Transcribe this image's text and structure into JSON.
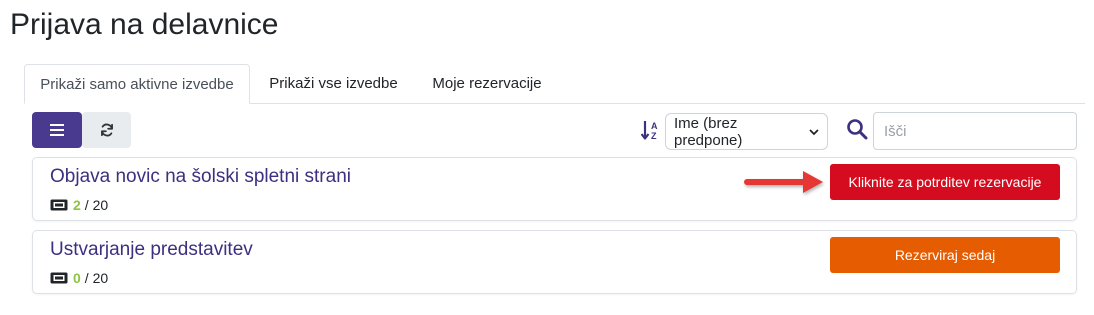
{
  "page": {
    "title": "Prijava na delavnice"
  },
  "tabs": [
    {
      "label": "Prikaži samo aktivne izvedbe",
      "active": true
    },
    {
      "label": "Prikaži vse izvedbe",
      "active": false
    },
    {
      "label": "Moje rezervacije",
      "active": false
    }
  ],
  "toolbar": {
    "menu_icon": "hamburger-icon",
    "refresh_icon": "refresh-icon",
    "sort_icon": "sort-alpha-down-icon",
    "sort_value": "Ime (brez predpone)",
    "search_icon": "search-icon",
    "search_placeholder": "Išči"
  },
  "workshops": [
    {
      "title": "Objava novic na šolski spletni strani",
      "booked": "2",
      "capacity": "/ 20",
      "button_label": "Kliknite za potrditev rezervacije",
      "button_color": "#d50c1f"
    },
    {
      "title": "Ustvarjanje predstavitev",
      "booked": "0",
      "capacity": "/ 20",
      "button_label": "Rezerviraj sedaj",
      "button_color": "#e65c00"
    }
  ],
  "colors": {
    "primary": "#4a3a8f",
    "title_link": "#3e2f80",
    "count": "#8cc63f",
    "annotation_arrow": "#e53935"
  }
}
